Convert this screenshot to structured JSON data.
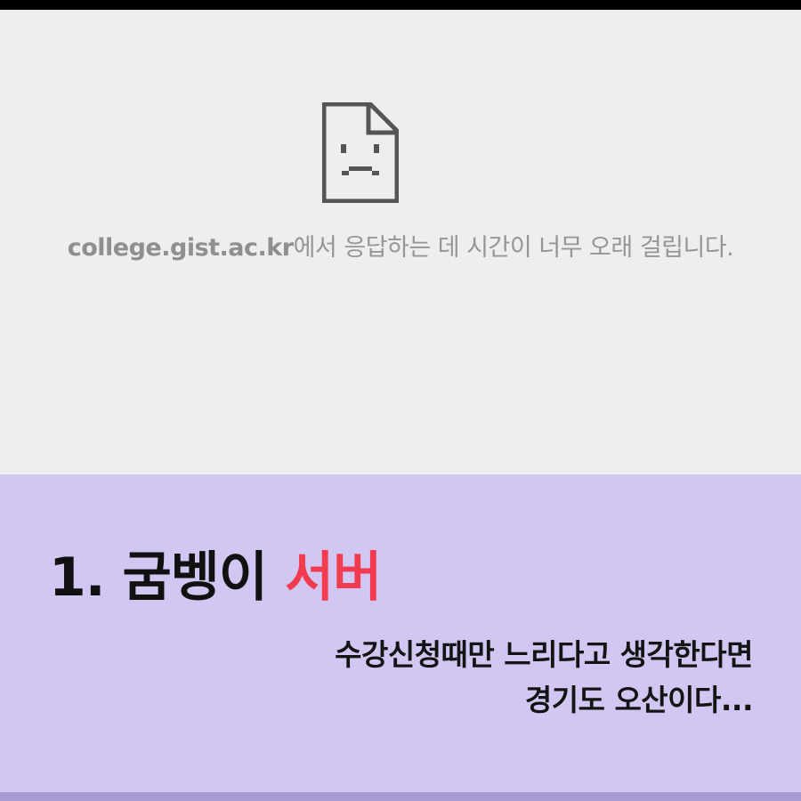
{
  "error_page": {
    "domain": "college.gist.ac.kr",
    "message": "에서 응답하는 데 시간이 너무 오래 걸립니다.",
    "icon": "sad-file-icon"
  },
  "caption": {
    "number": "1.",
    "title_plain": "굼벵이",
    "title_accent": "서버",
    "line1": "수강신청때만 느리다고 생각한다면",
    "line2": "경기도 오산이다..."
  },
  "colors": {
    "background": "#eeeeee",
    "caption_bg": "#d2c6f2",
    "accent": "#f33b4f",
    "icon": "#555555"
  }
}
